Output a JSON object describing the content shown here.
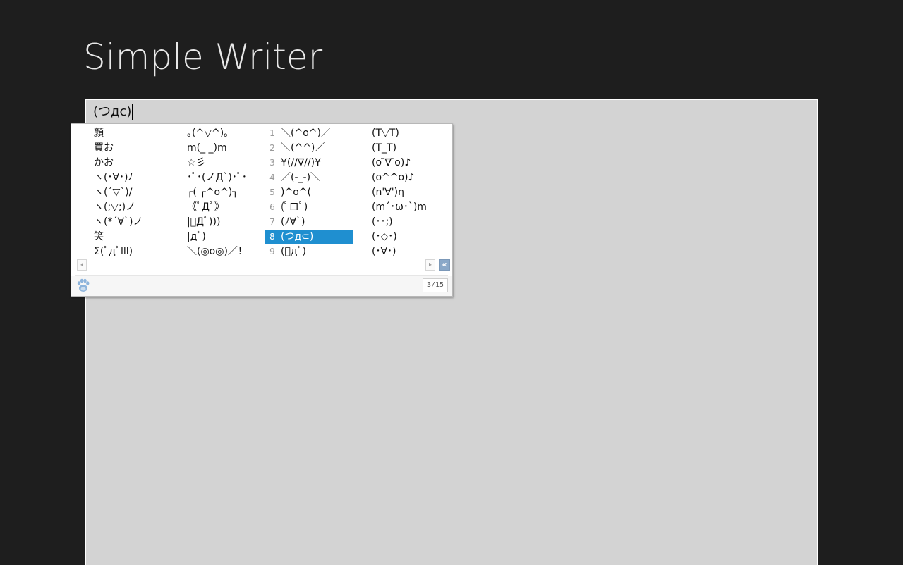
{
  "app": {
    "title": "Simple Writer"
  },
  "editor": {
    "composition_text": "(つдc)"
  },
  "ime": {
    "page_indicator": "3/15",
    "selected_index": 8,
    "columns": [
      [
        "顔",
        "買お",
        "かお",
        "ヽ(･∀･)ﾉ",
        "ヽ(´▽`)/",
        "ヽ(;▽;)ノ",
        "ヽ(*´∀`)ノ",
        "笑",
        "Σ(ﾟдﾟlll)"
      ],
      [
        "｡(^▽^)｡",
        "m(_ _)m",
        "☆彡",
        "･ﾟ･(ノД`)･ﾟ･",
        "┌( ┌^o^)┐",
        "《ﾟДﾟ》",
        "|ﾟДﾟ)))",
        "|дﾟ)",
        "＼(◎o◎)／！"
      ],
      [
        "＼(^o^)／",
        "＼(^^)／",
        "¥(//∇//)¥",
        "／(-_-)＼",
        ")^o^(",
        "(ﾟロﾟ)",
        "(ﾉ∀`)",
        "(つд⊂)",
        "(ﾟдﾟ)"
      ],
      [
        "(T▽T)",
        "(T_T)",
        "(o ̄∇ ̄o)♪",
        "(o^^o)♪",
        "(n'∀')η",
        "(m´･ω･`)m",
        "(･･;)",
        "(･◇･)",
        "(･∀･)"
      ]
    ],
    "numbers": [
      "1",
      "2",
      "3",
      "4",
      "5",
      "6",
      "7",
      "8",
      "9"
    ],
    "scroll_left_glyph": "◂",
    "scroll_right_glyph": "▸",
    "collapse_glyph": "«"
  },
  "colors": {
    "background": "#1e1e1e",
    "editor_bg": "#d3d3d3",
    "selection": "#1f8fd0",
    "paw": "#8db4dc"
  }
}
